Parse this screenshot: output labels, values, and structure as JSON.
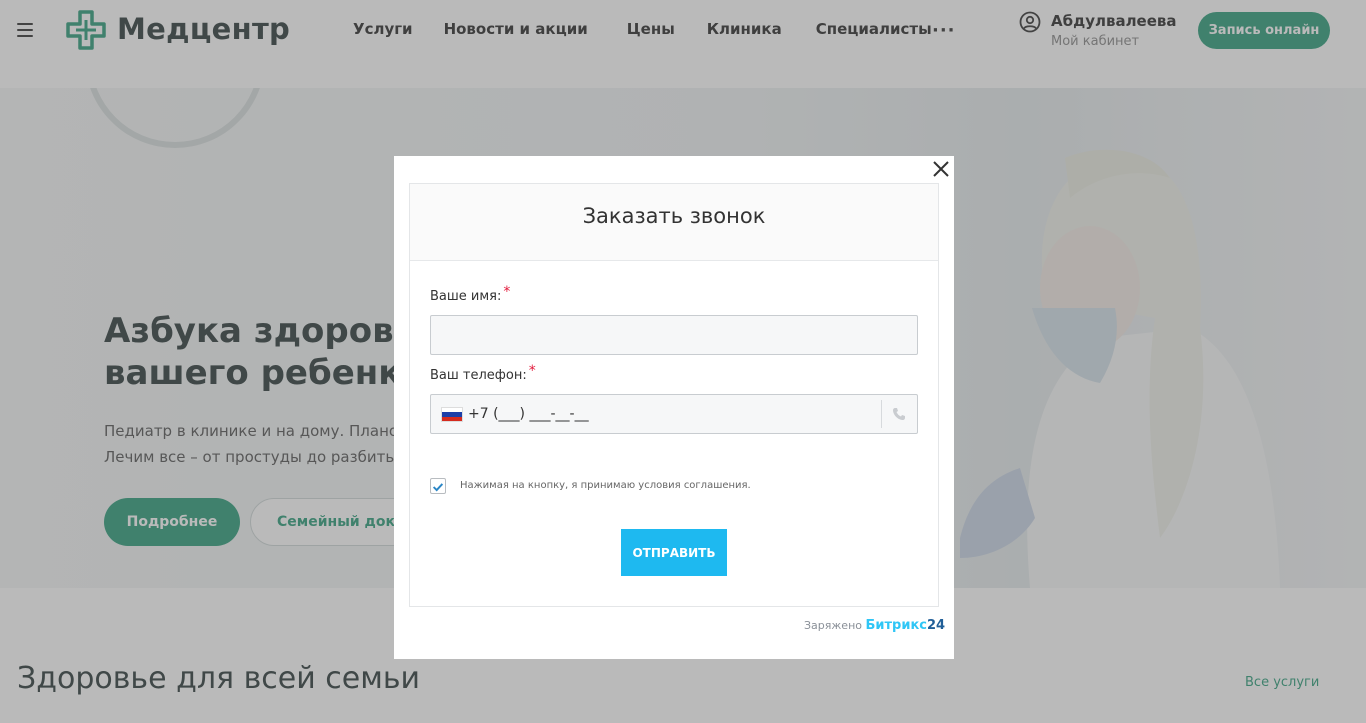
{
  "header": {
    "logo_text": "Медцентр",
    "nav": [
      "Услуги",
      "Новости и акции",
      "Цены",
      "Клиника",
      "Специалисты"
    ],
    "more": "···",
    "user_name": "Абдулвалеева",
    "user_cabinet": "Мой кабинет",
    "book_button": "Запись онлайн"
  },
  "hero": {
    "title_line1": "Азбука здоровья",
    "title_line2": "вашего ребенка",
    "text_line1": "Педиатр в клинике и на дому. Планов",
    "text_line2": "Лечим все – от простуды до разбитых",
    "button_more": "Подробнее",
    "button_family": "Семейный докт"
  },
  "section": {
    "title": "Здоровье для всей семьи",
    "all_link": "Все услуги"
  },
  "modal": {
    "title": "Заказать звонок",
    "name_label": "Ваше имя:",
    "name_value": "",
    "phone_label": "Ваш телефон:",
    "phone_value": "+7 (___) ___-__-__",
    "required_mark": "*",
    "agreement": "Нажимая на кнопку, я принимаю условия соглашения.",
    "agreement_checked": true,
    "submit": "ОТПРАВИТЬ",
    "powered_prefix": "Заряжено",
    "powered_brand": "Битрикс",
    "powered_num": "24"
  },
  "colors": {
    "brand_green": "#2e9e7a",
    "submit_blue": "#1eb9f0",
    "required_red": "#e21b3c"
  }
}
